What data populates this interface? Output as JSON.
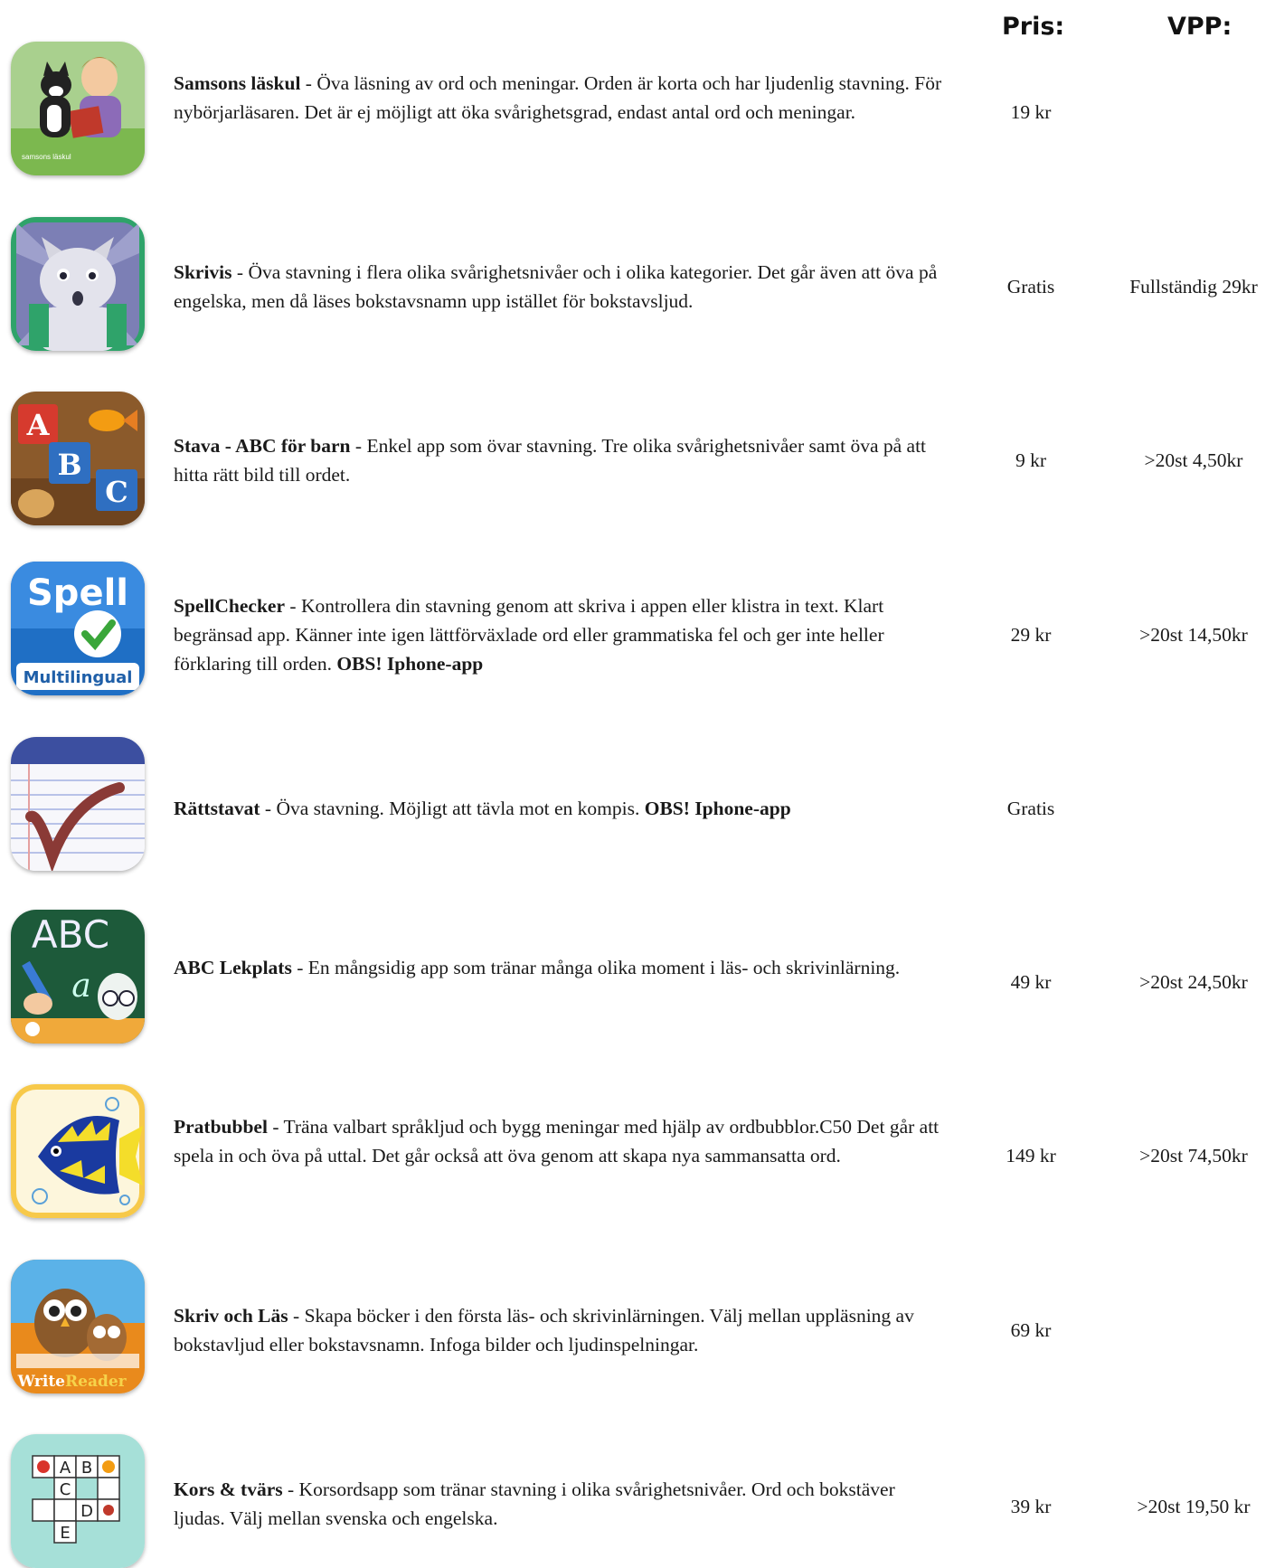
{
  "headers": {
    "price": "Pris:",
    "vpp": "VPP:"
  },
  "apps": [
    {
      "name": "Samsons läskul",
      "sep": " - ",
      "description": "Öva läsning av ord och meningar. Orden är korta och har ljudenlig stavning. För nybörjarläsaren. Det är ej möjligt att öka svårighetsgrad, endast antal ord och meningar.",
      "obs": "",
      "price": "19 kr",
      "vpp": "",
      "icon": "samsons-laskul-icon",
      "icon_label": "samsons läskul"
    },
    {
      "name": "Skrivis",
      "sep": " - ",
      "description": "Öva stavning i flera olika svårighetsnivåer och i olika kategorier. Det går även att öva på engelska, men då läses bokstavsnamn upp istället för bokstavsljud.",
      "obs": "",
      "price": "Gratis",
      "vpp": "Fullständig 29kr",
      "icon": "skrivis-cat-icon"
    },
    {
      "name": "Stava - ABC för barn",
      "sep": " - ",
      "description": "Enkel app som övar stavning. Tre olika svårighetsnivåer samt öva på att hitta rätt bild till ordet.",
      "obs": "",
      "price": "9 kr",
      "vpp": ">20st 4,50kr",
      "icon": "abc-blocks-icon",
      "icon_letters": [
        "A",
        "B",
        "C"
      ]
    },
    {
      "name": "SpellChecker",
      "sep": " - ",
      "description": "Kontrollera din stavning genom att skriva i appen eller klistra in text. Klart begränsad app. Känner inte igen lättförväxlade ord eller grammatiska fel och ger inte heller förklaring till orden. ",
      "obs": "OBS! Iphone-app",
      "price": "29 kr",
      "vpp": ">20st 14,50kr",
      "icon": "spellchecker-icon",
      "icon_title": "Spell",
      "icon_sub": "Multilingual"
    },
    {
      "name": "Rättstavat",
      "sep": " - ",
      "description": "Öva stavning. Möjligt att tävla mot en kompis. ",
      "obs": "OBS! Iphone-app",
      "price": "Gratis",
      "vpp": "",
      "icon": "rattstavat-notepad-icon"
    },
    {
      "name": "ABC Lekplats",
      "sep": " - ",
      "description": "En mångsidig app som tränar många olika moment i läs- och skrivinlärning.",
      "obs": "",
      "price": "49 kr",
      "vpp": ">20st 24,50kr",
      "icon": "abc-chalkboard-icon",
      "icon_title": "ABC",
      "icon_sub": "a"
    },
    {
      "name": "Pratbubbel",
      "sep": " - ",
      "description": "Träna valbart språkljud och bygg meningar med hjälp av ordbubblor.C50 Det går att spela in och öva på uttal. Det går också att öva genom att skapa nya sammansatta ord.",
      "obs": "",
      "price": "149 kr",
      "vpp": ">20st 74,50kr",
      "icon": "fish-icon"
    },
    {
      "name": "Skriv och Läs",
      "sep": " - ",
      "description": "Skapa böcker i den första läs- och skrivinlärningen. Välj mellan uppläsning av bokstavljud eller bokstavsnamn. Infoga bilder och ljudinspelningar.",
      "obs": "",
      "price": "69 kr",
      "vpp": "",
      "icon": "owl-writereader-icon",
      "icon_word1": "Write",
      "icon_word2": "Reader"
    },
    {
      "name": "Kors & tvärs",
      "sep": " - ",
      "description": "Korsordsapp som tränar stavning i olika svårighetsnivåer. Ord och bokstäver ljudas. Välj mellan svenska och engelska.",
      "obs": "",
      "price": "39 kr",
      "vpp": ">20st 19,50 kr",
      "icon": "crossword-icon",
      "icon_letters": [
        "A",
        "B",
        "C",
        "D",
        "E"
      ]
    }
  ]
}
